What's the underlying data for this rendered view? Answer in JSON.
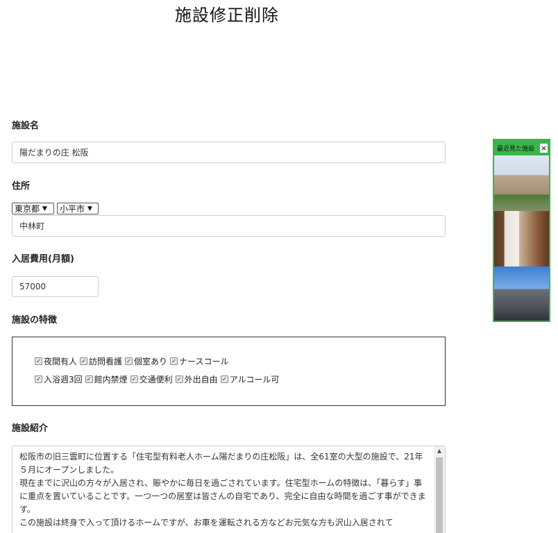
{
  "page": {
    "title": "施設修正削除"
  },
  "form": {
    "name_label": "施設名",
    "name_value": "陽だまりの庄 松阪",
    "address_label": "住所",
    "prefecture": "東京都",
    "city": "小平市",
    "address_value": "中林町",
    "fee_label": "入居費用(月額)",
    "fee_value": "57000",
    "features_label": "施設の特徴",
    "features_row1": [
      {
        "label": "夜間有人",
        "checked": true
      },
      {
        "label": "訪問看護",
        "checked": true
      },
      {
        "label": "個室あり",
        "checked": true
      },
      {
        "label": "ナースコール",
        "checked": true
      }
    ],
    "features_row2": [
      {
        "label": "入浴週3回",
        "checked": true
      },
      {
        "label": "館内禁煙",
        "checked": true
      },
      {
        "label": "交通便利",
        "checked": true
      },
      {
        "label": "外出自由",
        "checked": true
      },
      {
        "label": "アルコール可",
        "checked": true
      }
    ],
    "intro_label": "施設紹介",
    "intro_lines": [
      "松阪市の旧三雲町に位置する「住宅型有料老人ホーム陽だまりの庄松阪」は、全61室の大型の施設で、21年５月にオープンしました。",
      "現在までに沢山の方々が入居され、賑やかに毎日を過ごされています。住宅型ホームの特徴は、「暮らす」事に重点を置いていることです。一つ一つの居室は皆さんの自宅であり、完全に自由な時間を過ごす事ができます。",
      "この施設は終身で入って頂けるホームですが、お車を運転される方などお元気な方も沢山入居されて"
    ]
  },
  "recent": {
    "title": "最近見た施設",
    "close": "×",
    "thumbnails": [
      "building-exterior",
      "hallway-interior",
      "building-exterior-blue-sky"
    ]
  },
  "icons": {
    "checkbox": "checkbox-checked-icon",
    "select_arrow": "chevron-down-icon",
    "scroll_up": "scroll-up-arrow-icon"
  },
  "colors": {
    "recent_border": "#3bb54a",
    "features_border": "#333333",
    "input_border": "#cfcfcf"
  }
}
